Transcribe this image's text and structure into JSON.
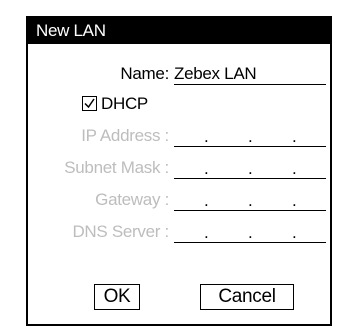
{
  "dialog": {
    "title": "New LAN"
  },
  "fields": {
    "name_label": "Name:",
    "name_value": "Zebex LAN",
    "dhcp_label": "DHCP",
    "dhcp_checked": true,
    "ip_address_label": "IP Address :",
    "subnet_mask_label": "Subnet Mask :",
    "gateway_label": "Gateway :",
    "dns_server_label": "DNS Server :",
    "ip_dot": "."
  },
  "buttons": {
    "ok_label": "OK",
    "cancel_label": "Cancel"
  },
  "colors": {
    "titlebar_bg": "#000000",
    "titlebar_fg": "#ffffff",
    "disabled_text": "#bdbdbd"
  },
  "icons": {
    "checkbox": "checkbox-checked-icon"
  }
}
